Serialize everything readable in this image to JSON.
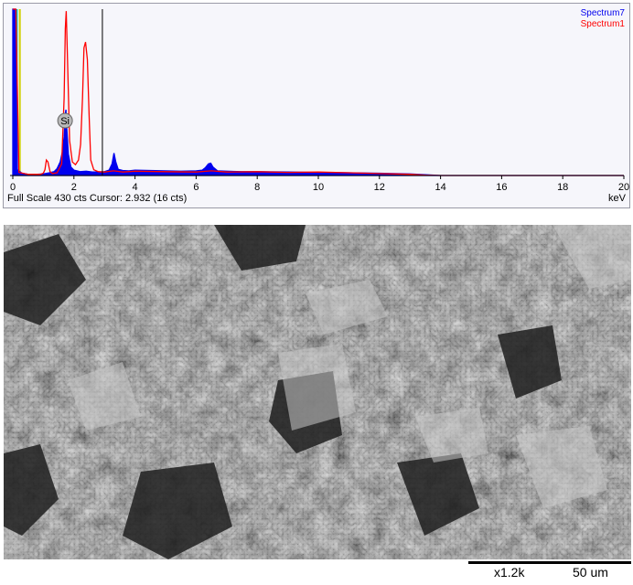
{
  "chart_data": {
    "type": "line",
    "xlabel": "keV",
    "xlim": [
      0,
      20
    ],
    "ylim": [
      0,
      430
    ],
    "x_ticks": [
      "0",
      "2",
      "4",
      "6",
      "8",
      "10",
      "12",
      "14",
      "16",
      "18",
      "20"
    ],
    "cursor_x": 2.932,
    "peak_label": "Si",
    "peak_label_x": 1.74,
    "status": "Full Scale 430 cts Cursor: 2.932  (16 cts)",
    "series": [
      {
        "name": "Spectrum7",
        "color": "#0000ee",
        "fill": true,
        "points": [
          [
            0,
            430
          ],
          [
            0.08,
            430
          ],
          [
            0.15,
            15
          ],
          [
            0.3,
            6
          ],
          [
            0.5,
            3
          ],
          [
            0.8,
            3
          ],
          [
            1.0,
            4
          ],
          [
            1.2,
            7
          ],
          [
            1.35,
            10
          ],
          [
            1.45,
            18
          ],
          [
            1.55,
            35
          ],
          [
            1.62,
            60
          ],
          [
            1.68,
            100
          ],
          [
            1.72,
            160
          ],
          [
            1.74,
            170
          ],
          [
            1.77,
            120
          ],
          [
            1.82,
            55
          ],
          [
            1.9,
            22
          ],
          [
            2.0,
            14
          ],
          [
            2.2,
            10
          ],
          [
            2.4,
            11
          ],
          [
            2.6,
            9
          ],
          [
            2.8,
            9
          ],
          [
            3.0,
            10
          ],
          [
            3.15,
            14
          ],
          [
            3.25,
            30
          ],
          [
            3.31,
            58
          ],
          [
            3.37,
            35
          ],
          [
            3.45,
            16
          ],
          [
            3.6,
            13
          ],
          [
            3.8,
            12
          ],
          [
            4.0,
            14
          ],
          [
            4.5,
            13
          ],
          [
            5.0,
            12
          ],
          [
            5.5,
            11
          ],
          [
            6.0,
            12
          ],
          [
            6.2,
            14
          ],
          [
            6.3,
            20
          ],
          [
            6.4,
            30
          ],
          [
            6.48,
            32
          ],
          [
            6.55,
            22
          ],
          [
            6.7,
            12
          ],
          [
            7.0,
            11
          ],
          [
            7.5,
            10
          ],
          [
            8.0,
            10
          ],
          [
            9.0,
            9
          ],
          [
            10.0,
            8
          ],
          [
            11.0,
            7
          ],
          [
            12.0,
            6
          ],
          [
            13.0,
            4
          ],
          [
            13.5,
            2
          ],
          [
            14,
            0
          ],
          [
            20,
            0
          ]
        ]
      },
      {
        "name": "Spectrum1",
        "color": "#ff0000",
        "fill": false,
        "points": [
          [
            0,
            430
          ],
          [
            0.1,
            430
          ],
          [
            0.2,
            8
          ],
          [
            0.5,
            3
          ],
          [
            0.9,
            3
          ],
          [
            1.0,
            6
          ],
          [
            1.05,
            15
          ],
          [
            1.1,
            40
          ],
          [
            1.15,
            35
          ],
          [
            1.22,
            10
          ],
          [
            1.3,
            5
          ],
          [
            1.45,
            7
          ],
          [
            1.6,
            30
          ],
          [
            1.68,
            200
          ],
          [
            1.72,
            380
          ],
          [
            1.75,
            425
          ],
          [
            1.79,
            300
          ],
          [
            1.86,
            90
          ],
          [
            1.95,
            35
          ],
          [
            2.05,
            28
          ],
          [
            2.15,
            40
          ],
          [
            2.22,
            80
          ],
          [
            2.28,
            200
          ],
          [
            2.33,
            330
          ],
          [
            2.38,
            345
          ],
          [
            2.44,
            300
          ],
          [
            2.5,
            150
          ],
          [
            2.55,
            40
          ],
          [
            2.65,
            15
          ],
          [
            2.8,
            10
          ],
          [
            3.0,
            9
          ],
          [
            3.3,
            12
          ],
          [
            3.6,
            9
          ],
          [
            4.0,
            11
          ],
          [
            5.0,
            10
          ],
          [
            6.0,
            9
          ],
          [
            6.5,
            12
          ],
          [
            7.0,
            9
          ],
          [
            8.0,
            10
          ],
          [
            9.0,
            8
          ],
          [
            10.0,
            9
          ],
          [
            11.0,
            7
          ],
          [
            12.0,
            5
          ],
          [
            13.0,
            3
          ],
          [
            13.5,
            1
          ],
          [
            14,
            0
          ],
          [
            20,
            0
          ]
        ]
      }
    ],
    "baseline_markers": [
      {
        "x": 0.02,
        "color": "#00b000"
      },
      {
        "x": 0.1,
        "color": "#00b0b0"
      },
      {
        "x": 0.2,
        "color": "#d0d000"
      }
    ]
  },
  "sem": {
    "magnification": "x1.2k",
    "scale_label": "50 um"
  }
}
